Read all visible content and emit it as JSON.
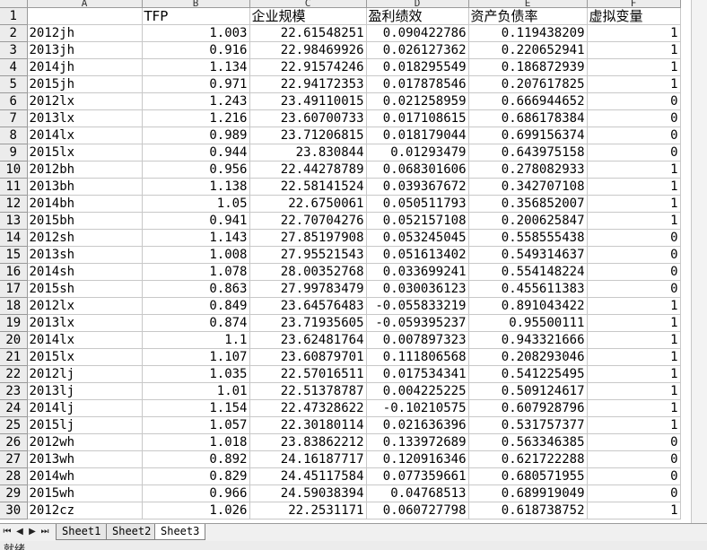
{
  "columns": [
    "A",
    "B",
    "C",
    "D",
    "E",
    "F"
  ],
  "header_row": {
    "row": "1",
    "cells": [
      "",
      "TFP",
      "企业规模",
      "盈利绩效",
      "资产负债率",
      "虚拟变量"
    ]
  },
  "rows": [
    {
      "row": "2",
      "cells": [
        "2012jh",
        "1.003",
        "22.61548251",
        "0.090422786",
        "0.119438209",
        "1"
      ]
    },
    {
      "row": "3",
      "cells": [
        "2013jh",
        "0.916",
        "22.98469926",
        "0.026127362",
        "0.220652941",
        "1"
      ]
    },
    {
      "row": "4",
      "cells": [
        "2014jh",
        "1.134",
        "22.91574246",
        "0.018295549",
        "0.186872939",
        "1"
      ]
    },
    {
      "row": "5",
      "cells": [
        "2015jh",
        "0.971",
        "22.94172353",
        "0.017878546",
        "0.207617825",
        "1"
      ]
    },
    {
      "row": "6",
      "cells": [
        "2012lx",
        "1.243",
        "23.49110015",
        "0.021258959",
        "0.666944652",
        "0"
      ]
    },
    {
      "row": "7",
      "cells": [
        "2013lx",
        "1.216",
        "23.60700733",
        "0.017108615",
        "0.686178384",
        "0"
      ]
    },
    {
      "row": "8",
      "cells": [
        "2014lx",
        "0.989",
        "23.71206815",
        "0.018179044",
        "0.699156374",
        "0"
      ]
    },
    {
      "row": "9",
      "cells": [
        "2015lx",
        "0.944",
        "23.830844",
        "0.01293479",
        "0.643975158",
        "0"
      ]
    },
    {
      "row": "10",
      "cells": [
        "2012bh",
        "0.956",
        "22.44278789",
        "0.068301606",
        "0.278082933",
        "1"
      ]
    },
    {
      "row": "11",
      "cells": [
        "2013bh",
        "1.138",
        "22.58141524",
        "0.039367672",
        "0.342707108",
        "1"
      ]
    },
    {
      "row": "12",
      "cells": [
        "2014bh",
        "1.05",
        "22.6750061",
        "0.050511793",
        "0.356852007",
        "1"
      ]
    },
    {
      "row": "13",
      "cells": [
        "2015bh",
        "0.941",
        "22.70704276",
        "0.052157108",
        "0.200625847",
        "1"
      ]
    },
    {
      "row": "14",
      "cells": [
        "2012sh",
        "1.143",
        "27.85197908",
        "0.053245045",
        "0.558555438",
        "0"
      ]
    },
    {
      "row": "15",
      "cells": [
        "2013sh",
        "1.008",
        "27.95521543",
        "0.051613402",
        "0.549314637",
        "0"
      ]
    },
    {
      "row": "16",
      "cells": [
        "2014sh",
        "1.078",
        "28.00352768",
        "0.033699241",
        "0.554148224",
        "0"
      ]
    },
    {
      "row": "17",
      "cells": [
        "2015sh",
        "0.863",
        "27.99783479",
        "0.030036123",
        "0.455611383",
        "0"
      ]
    },
    {
      "row": "18",
      "cells": [
        "2012lx",
        "0.849",
        "23.64576483",
        "-0.055833219",
        "0.891043422",
        "1"
      ]
    },
    {
      "row": "19",
      "cells": [
        "2013lx",
        "0.874",
        "23.71935605",
        "-0.059395237",
        "0.95500111",
        "1"
      ]
    },
    {
      "row": "20",
      "cells": [
        "2014lx",
        "1.1",
        "23.62481764",
        "0.007897323",
        "0.943321666",
        "1"
      ]
    },
    {
      "row": "21",
      "cells": [
        "2015lx",
        "1.107",
        "23.60879701",
        "0.111806568",
        "0.208293046",
        "1"
      ]
    },
    {
      "row": "22",
      "cells": [
        "2012lj",
        "1.035",
        "22.57016511",
        "0.017534341",
        "0.541225495",
        "1"
      ]
    },
    {
      "row": "23",
      "cells": [
        "2013lj",
        "1.01",
        "22.51378787",
        "0.004225225",
        "0.509124617",
        "1"
      ]
    },
    {
      "row": "24",
      "cells": [
        "2014lj",
        "1.154",
        "22.47328622",
        "-0.10210575",
        "0.607928796",
        "1"
      ]
    },
    {
      "row": "25",
      "cells": [
        "2015lj",
        "1.057",
        "22.30180114",
        "0.021636396",
        "0.531757377",
        "1"
      ]
    },
    {
      "row": "26",
      "cells": [
        "2012wh",
        "1.018",
        "23.83862212",
        "0.133972689",
        "0.563346385",
        "0"
      ]
    },
    {
      "row": "27",
      "cells": [
        "2013wh",
        "0.892",
        "24.16187717",
        "0.120916346",
        "0.621722288",
        "0"
      ]
    },
    {
      "row": "28",
      "cells": [
        "2014wh",
        "0.829",
        "24.45117584",
        "0.077359661",
        "0.680571955",
        "0"
      ]
    },
    {
      "row": "29",
      "cells": [
        "2015wh",
        "0.966",
        "24.59038394",
        "0.04768513",
        "0.689919049",
        "0"
      ]
    },
    {
      "row": "30",
      "cells": [
        "2012cz",
        "1.026",
        "22.2531171",
        "0.060727798",
        "0.618738752",
        "1"
      ]
    }
  ],
  "tabs": [
    "Sheet1",
    "Sheet2",
    "Sheet3"
  ],
  "active_tab": "Sheet3",
  "status_text": "就绪"
}
